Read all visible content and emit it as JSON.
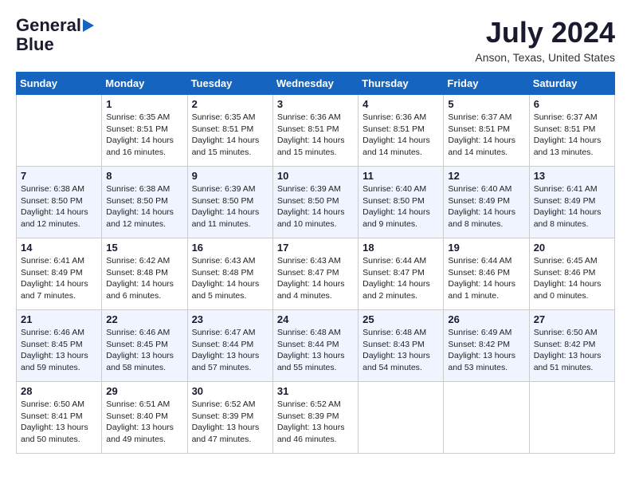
{
  "header": {
    "logo_line1": "General",
    "logo_line2": "Blue",
    "month": "July 2024",
    "location": "Anson, Texas, United States"
  },
  "days_of_week": [
    "Sunday",
    "Monday",
    "Tuesday",
    "Wednesday",
    "Thursday",
    "Friday",
    "Saturday"
  ],
  "weeks": [
    [
      {
        "day": "",
        "info": ""
      },
      {
        "day": "1",
        "info": "Sunrise: 6:35 AM\nSunset: 8:51 PM\nDaylight: 14 hours\nand 16 minutes."
      },
      {
        "day": "2",
        "info": "Sunrise: 6:35 AM\nSunset: 8:51 PM\nDaylight: 14 hours\nand 15 minutes."
      },
      {
        "day": "3",
        "info": "Sunrise: 6:36 AM\nSunset: 8:51 PM\nDaylight: 14 hours\nand 15 minutes."
      },
      {
        "day": "4",
        "info": "Sunrise: 6:36 AM\nSunset: 8:51 PM\nDaylight: 14 hours\nand 14 minutes."
      },
      {
        "day": "5",
        "info": "Sunrise: 6:37 AM\nSunset: 8:51 PM\nDaylight: 14 hours\nand 14 minutes."
      },
      {
        "day": "6",
        "info": "Sunrise: 6:37 AM\nSunset: 8:51 PM\nDaylight: 14 hours\nand 13 minutes."
      }
    ],
    [
      {
        "day": "7",
        "info": "Sunrise: 6:38 AM\nSunset: 8:50 PM\nDaylight: 14 hours\nand 12 minutes."
      },
      {
        "day": "8",
        "info": "Sunrise: 6:38 AM\nSunset: 8:50 PM\nDaylight: 14 hours\nand 12 minutes."
      },
      {
        "day": "9",
        "info": "Sunrise: 6:39 AM\nSunset: 8:50 PM\nDaylight: 14 hours\nand 11 minutes."
      },
      {
        "day": "10",
        "info": "Sunrise: 6:39 AM\nSunset: 8:50 PM\nDaylight: 14 hours\nand 10 minutes."
      },
      {
        "day": "11",
        "info": "Sunrise: 6:40 AM\nSunset: 8:50 PM\nDaylight: 14 hours\nand 9 minutes."
      },
      {
        "day": "12",
        "info": "Sunrise: 6:40 AM\nSunset: 8:49 PM\nDaylight: 14 hours\nand 8 minutes."
      },
      {
        "day": "13",
        "info": "Sunrise: 6:41 AM\nSunset: 8:49 PM\nDaylight: 14 hours\nand 8 minutes."
      }
    ],
    [
      {
        "day": "14",
        "info": "Sunrise: 6:41 AM\nSunset: 8:49 PM\nDaylight: 14 hours\nand 7 minutes."
      },
      {
        "day": "15",
        "info": "Sunrise: 6:42 AM\nSunset: 8:48 PM\nDaylight: 14 hours\nand 6 minutes."
      },
      {
        "day": "16",
        "info": "Sunrise: 6:43 AM\nSunset: 8:48 PM\nDaylight: 14 hours\nand 5 minutes."
      },
      {
        "day": "17",
        "info": "Sunrise: 6:43 AM\nSunset: 8:47 PM\nDaylight: 14 hours\nand 4 minutes."
      },
      {
        "day": "18",
        "info": "Sunrise: 6:44 AM\nSunset: 8:47 PM\nDaylight: 14 hours\nand 2 minutes."
      },
      {
        "day": "19",
        "info": "Sunrise: 6:44 AM\nSunset: 8:46 PM\nDaylight: 14 hours\nand 1 minute."
      },
      {
        "day": "20",
        "info": "Sunrise: 6:45 AM\nSunset: 8:46 PM\nDaylight: 14 hours\nand 0 minutes."
      }
    ],
    [
      {
        "day": "21",
        "info": "Sunrise: 6:46 AM\nSunset: 8:45 PM\nDaylight: 13 hours\nand 59 minutes."
      },
      {
        "day": "22",
        "info": "Sunrise: 6:46 AM\nSunset: 8:45 PM\nDaylight: 13 hours\nand 58 minutes."
      },
      {
        "day": "23",
        "info": "Sunrise: 6:47 AM\nSunset: 8:44 PM\nDaylight: 13 hours\nand 57 minutes."
      },
      {
        "day": "24",
        "info": "Sunrise: 6:48 AM\nSunset: 8:44 PM\nDaylight: 13 hours\nand 55 minutes."
      },
      {
        "day": "25",
        "info": "Sunrise: 6:48 AM\nSunset: 8:43 PM\nDaylight: 13 hours\nand 54 minutes."
      },
      {
        "day": "26",
        "info": "Sunrise: 6:49 AM\nSunset: 8:42 PM\nDaylight: 13 hours\nand 53 minutes."
      },
      {
        "day": "27",
        "info": "Sunrise: 6:50 AM\nSunset: 8:42 PM\nDaylight: 13 hours\nand 51 minutes."
      }
    ],
    [
      {
        "day": "28",
        "info": "Sunrise: 6:50 AM\nSunset: 8:41 PM\nDaylight: 13 hours\nand 50 minutes."
      },
      {
        "day": "29",
        "info": "Sunrise: 6:51 AM\nSunset: 8:40 PM\nDaylight: 13 hours\nand 49 minutes."
      },
      {
        "day": "30",
        "info": "Sunrise: 6:52 AM\nSunset: 8:39 PM\nDaylight: 13 hours\nand 47 minutes."
      },
      {
        "day": "31",
        "info": "Sunrise: 6:52 AM\nSunset: 8:39 PM\nDaylight: 13 hours\nand 46 minutes."
      },
      {
        "day": "",
        "info": ""
      },
      {
        "day": "",
        "info": ""
      },
      {
        "day": "",
        "info": ""
      }
    ]
  ]
}
